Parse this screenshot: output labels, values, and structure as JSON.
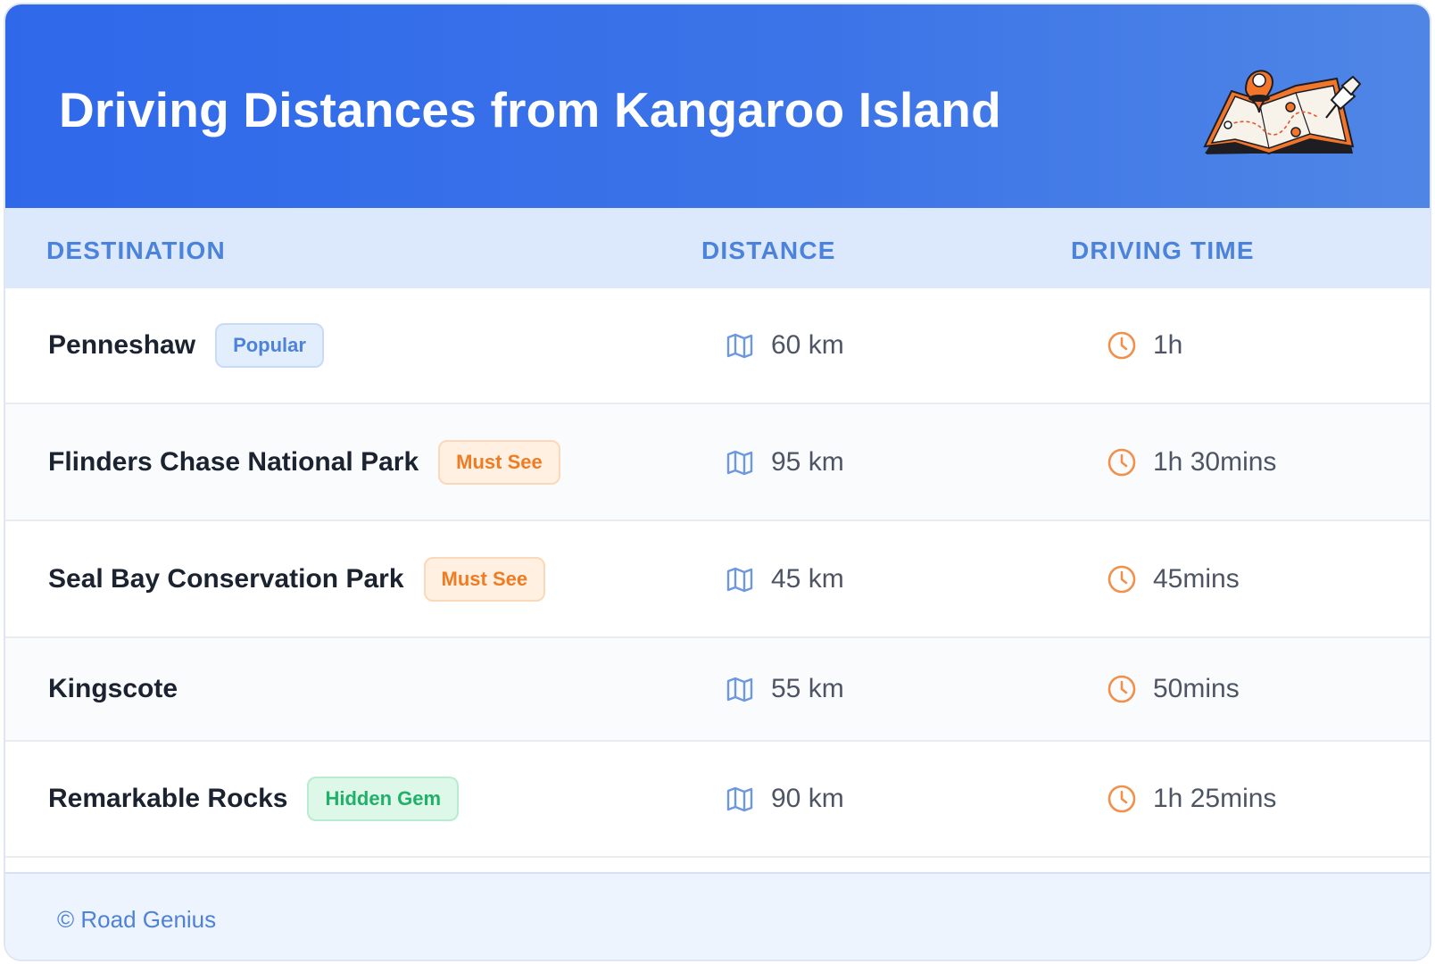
{
  "title": "Driving Distances from Kangaroo Island",
  "columns": {
    "destination": "DESTINATION",
    "distance": "DISTANCE",
    "driving_time": "DRIVING TIME"
  },
  "rows": [
    {
      "destination": "Penneshaw",
      "badge": "Popular",
      "badge_type": "popular",
      "distance": "60 km",
      "time": "1h"
    },
    {
      "destination": "Flinders Chase National Park",
      "badge": "Must See",
      "badge_type": "must",
      "distance": "95 km",
      "time": "1h 30mins"
    },
    {
      "destination": "Seal Bay Conservation Park",
      "badge": "Must See",
      "badge_type": "must",
      "distance": "45 km",
      "time": "45mins"
    },
    {
      "destination": "Kingscote",
      "badge": "",
      "badge_type": "",
      "distance": "55 km",
      "time": "50mins"
    },
    {
      "destination": "Remarkable Rocks",
      "badge": "Hidden Gem",
      "badge_type": "gem",
      "distance": "90 km",
      "time": "1h 25mins"
    }
  ],
  "footer": "© Road Genius",
  "icons": {
    "distance": "map-icon",
    "time": "clock-icon",
    "header": "map-pin-illustration"
  },
  "colors": {
    "header_start": "#2f69ea",
    "header_end": "#4f86e6",
    "accent_blue": "#4a82dc",
    "accent_orange": "#ef7c22",
    "accent_green": "#20b06a"
  }
}
